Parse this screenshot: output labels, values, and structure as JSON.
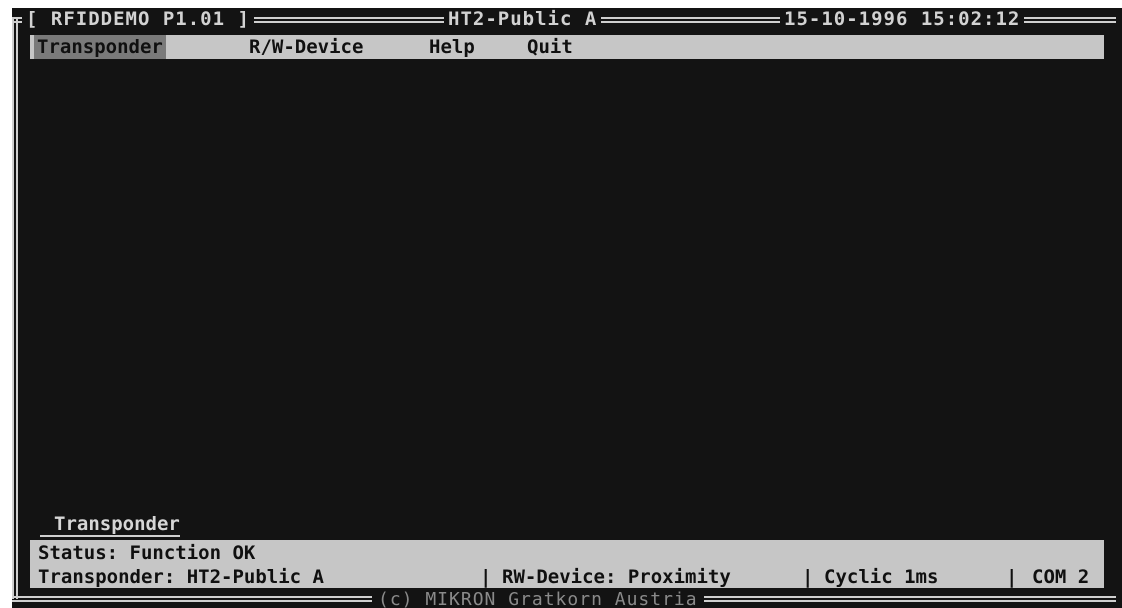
{
  "window": {
    "app_title": "RFIDDEMO P1.01",
    "transponder_type": "HT2-Public A",
    "datetime": "15-10-1996 15:02:12"
  },
  "menu": {
    "items": [
      {
        "label": "Transponder",
        "active": true
      },
      {
        "label": "R/W-Device",
        "active": false
      },
      {
        "label": "Help",
        "active": false
      },
      {
        "label": "Quit",
        "active": false
      }
    ]
  },
  "panel": {
    "caption": "Transponder"
  },
  "status": {
    "line1": "Status: Function OK",
    "transponder": "Transponder: HT2-Public A",
    "rw_device": "RW-Device: Proximity",
    "mode": "Cyclic 1ms",
    "port": "COM 2",
    "separator": "|"
  },
  "footer": {
    "copyright": "(c) MIKRON Gratkorn Austria"
  },
  "colors": {
    "background": "#131313",
    "bar": "#c6c6c6",
    "highlight": "#7a7a7a",
    "frame": "#cfcfcf"
  }
}
